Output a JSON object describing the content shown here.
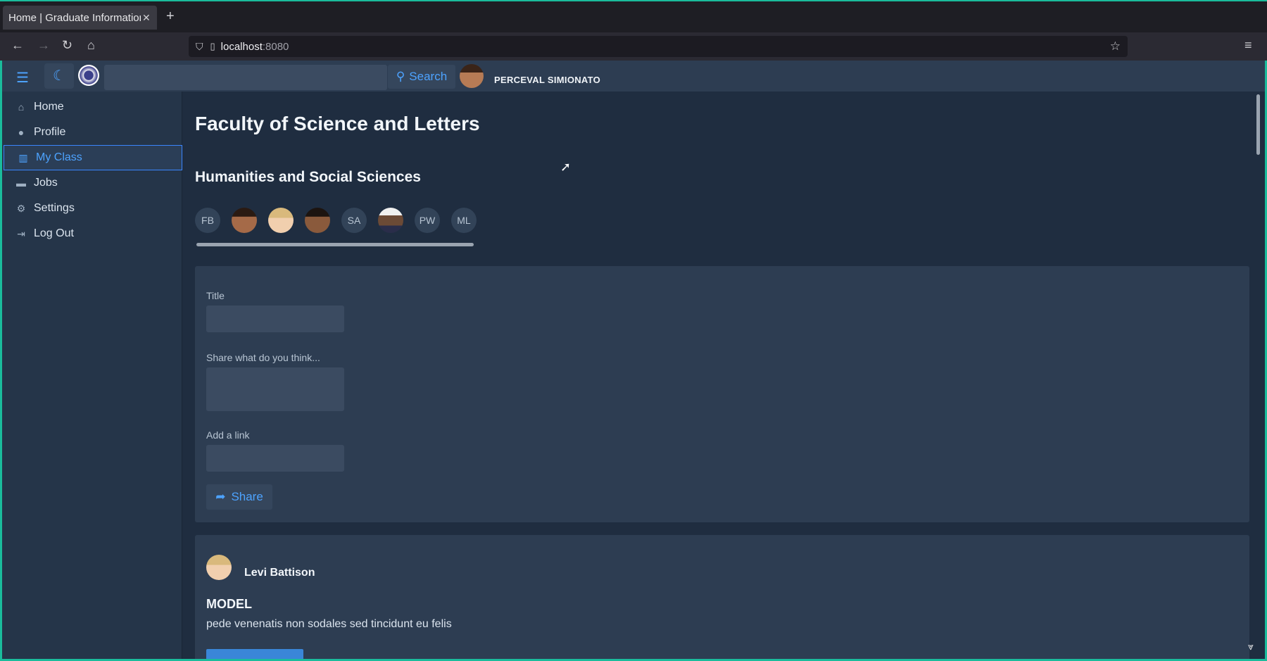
{
  "browser": {
    "tab_title": "Home | Graduate Information",
    "url_host": "localhost",
    "url_port": ":8080"
  },
  "topbar": {
    "search_label": "Search",
    "user_name": "PERCEVAL SIMIONATO"
  },
  "sidebar": {
    "items": [
      {
        "label": "Home",
        "icon": "home-icon"
      },
      {
        "label": "Profile",
        "icon": "user-icon"
      },
      {
        "label": "My Class",
        "icon": "building-icon"
      },
      {
        "label": "Jobs",
        "icon": "briefcase-icon"
      },
      {
        "label": "Settings",
        "icon": "gear-icon"
      },
      {
        "label": "Log Out",
        "icon": "logout-icon"
      }
    ],
    "active": "My Class"
  },
  "main": {
    "faculty": "Faculty of Science and Letters",
    "department": "Humanities and Social Sciences",
    "members": [
      {
        "initials": "FB",
        "photo": false
      },
      {
        "initials": "",
        "photo": true
      },
      {
        "initials": "",
        "photo": true
      },
      {
        "initials": "",
        "photo": true
      },
      {
        "initials": "SA",
        "photo": false
      },
      {
        "initials": "",
        "photo": true
      },
      {
        "initials": "PW",
        "photo": false
      },
      {
        "initials": "ML",
        "photo": false
      }
    ],
    "form": {
      "title_label": "Title",
      "body_label": "Share what do you think...",
      "link_label": "Add a link",
      "share_label": "Share"
    },
    "post": {
      "author": "Levi Battison",
      "title": "MODEL",
      "body": "pede venenatis non sodales sed tincidunt eu felis"
    }
  },
  "colors": {
    "accent": "#4da3ff",
    "background": "#1f2d40",
    "card": "#2d3d52",
    "frame": "#1abc9c"
  }
}
